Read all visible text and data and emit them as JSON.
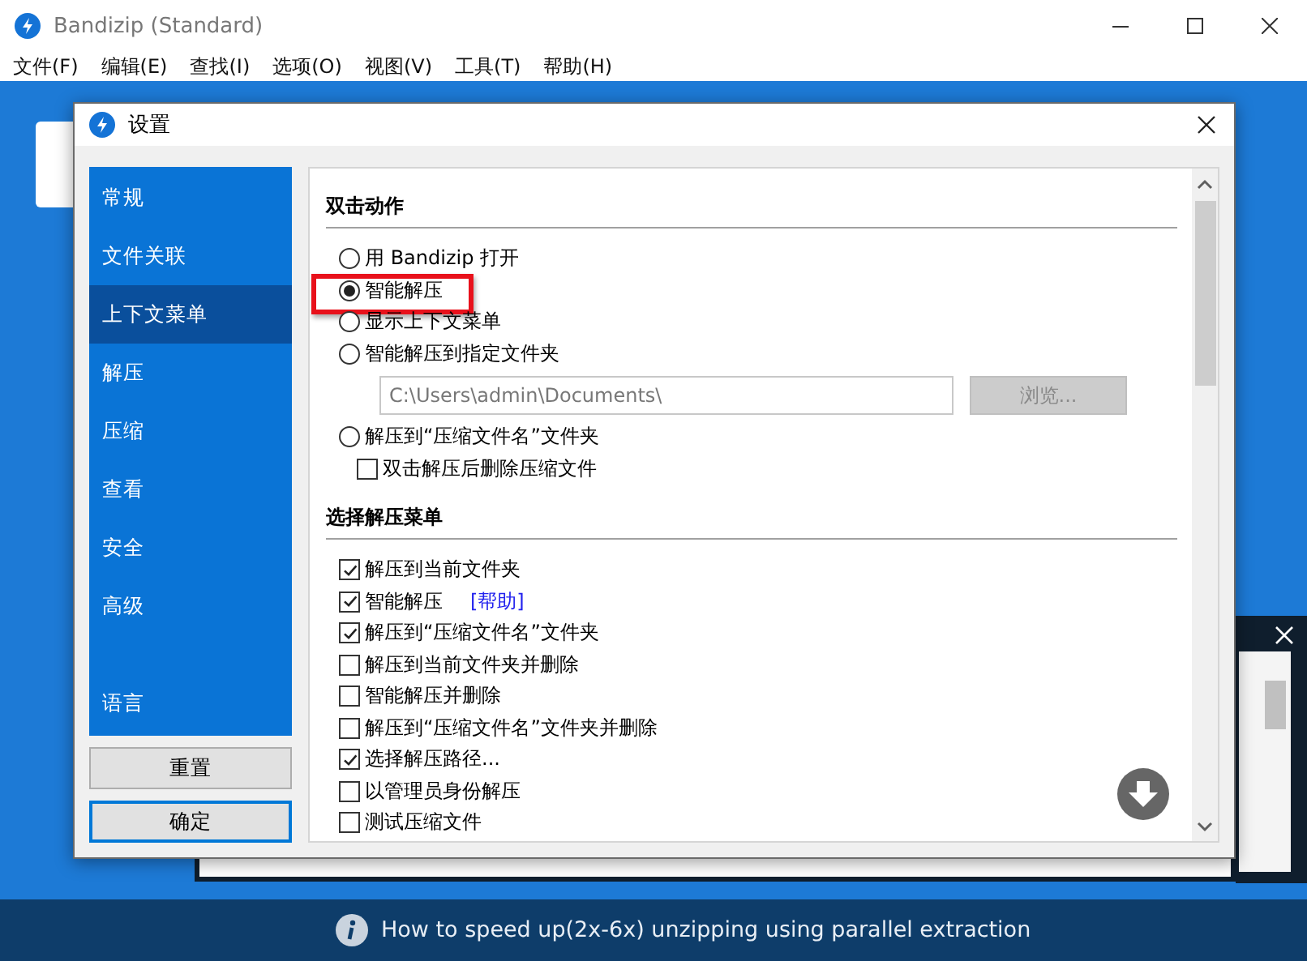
{
  "window": {
    "title": "Bandizip (Standard)"
  },
  "menu": [
    "文件(F)",
    "编辑(E)",
    "查找(I)",
    "选项(O)",
    "视图(V)",
    "工具(T)",
    "帮助(H)"
  ],
  "dialog": {
    "title": "设置",
    "sidebar": [
      {
        "label": "常规",
        "selected": false
      },
      {
        "label": "文件关联",
        "selected": false
      },
      {
        "label": "上下文菜单",
        "selected": true
      },
      {
        "label": "解压",
        "selected": false
      },
      {
        "label": "压缩",
        "selected": false
      },
      {
        "label": "查看",
        "selected": false
      },
      {
        "label": "安全",
        "selected": false
      },
      {
        "label": "高级",
        "selected": false
      },
      {
        "label": "语言",
        "selected": false
      }
    ],
    "buttons": [
      {
        "label": "重置",
        "kind": "normal"
      },
      {
        "label": "确定",
        "kind": "default"
      }
    ],
    "sections": [
      {
        "heading": "双击动作",
        "items": [
          {
            "kind": "radio",
            "label": "用 Bandizip 打开",
            "selected": false
          },
          {
            "kind": "radio",
            "label": "智能解压",
            "selected": true,
            "highlighted": true
          },
          {
            "kind": "radio",
            "label": "显示上下文菜单",
            "selected": false
          },
          {
            "kind": "radio",
            "label": "智能解压到指定文件夹",
            "selected": false
          },
          {
            "kind": "path",
            "value": "C:\\Users\\admin\\Documents\\",
            "button": "浏览...",
            "disabled": true
          },
          {
            "kind": "radio",
            "label": "解压到“压缩文件名”文件夹",
            "selected": false
          },
          {
            "kind": "checkbox",
            "label": "双击解压后删除压缩文件",
            "checked": false,
            "indent": true
          }
        ]
      },
      {
        "heading": "选择解压菜单",
        "items": [
          {
            "kind": "checkbox",
            "label": "解压到当前文件夹",
            "checked": true
          },
          {
            "kind": "checkbox",
            "label": "智能解压",
            "checked": true,
            "link": "[帮助]"
          },
          {
            "kind": "checkbox",
            "label": "解压到“压缩文件名”文件夹",
            "checked": true
          },
          {
            "kind": "checkbox",
            "label": "解压到当前文件夹并删除",
            "checked": false
          },
          {
            "kind": "checkbox",
            "label": "智能解压并删除",
            "checked": false
          },
          {
            "kind": "checkbox",
            "label": "解压到“压缩文件名”文件夹并删除",
            "checked": false
          },
          {
            "kind": "checkbox",
            "label": "选择解压路径...",
            "checked": true
          },
          {
            "kind": "checkbox",
            "label": "以管理员身份解压",
            "checked": false
          },
          {
            "kind": "checkbox",
            "label": "测试压缩文件",
            "checked": false
          }
        ]
      }
    ]
  },
  "status_bar": {
    "text": "How to speed up(2x-6x) unzipping using parallel extraction"
  }
}
